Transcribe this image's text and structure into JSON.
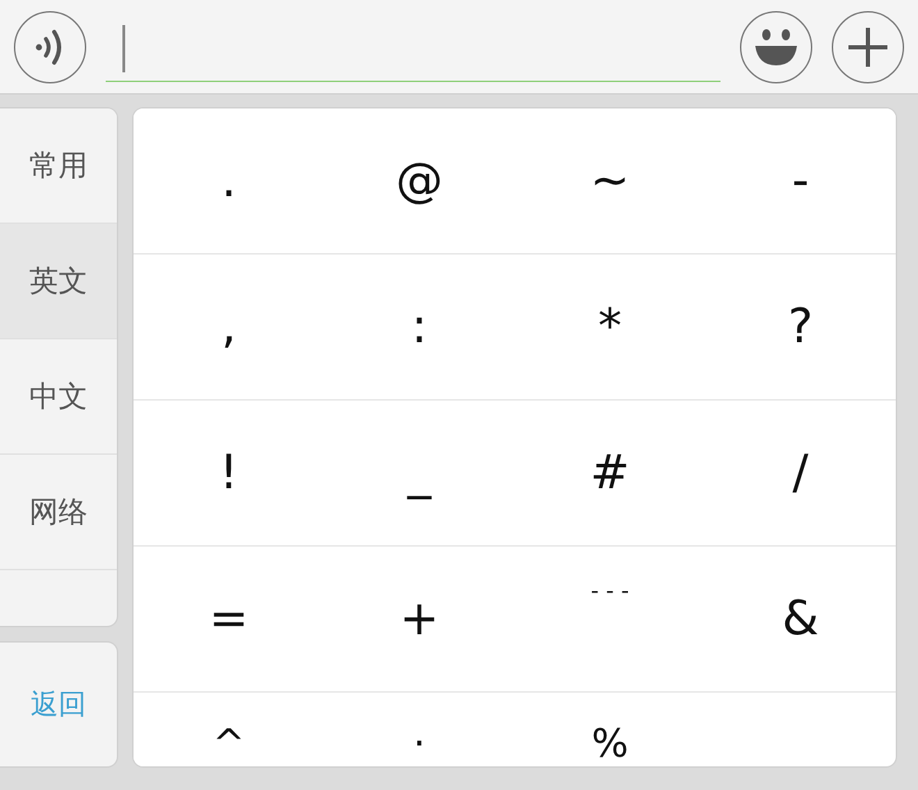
{
  "categories": [
    {
      "label": "常用",
      "selected": false
    },
    {
      "label": "英文",
      "selected": true
    },
    {
      "label": "中文",
      "selected": false
    },
    {
      "label": "网络",
      "selected": false
    }
  ],
  "back_button": "返回",
  "symbols": [
    ".",
    "@",
    "~",
    "-",
    ",",
    ":",
    "*",
    "?",
    "!",
    "_",
    "#",
    "/",
    "=",
    "+",
    "- - -",
    "&",
    "^",
    "·",
    "%"
  ]
}
